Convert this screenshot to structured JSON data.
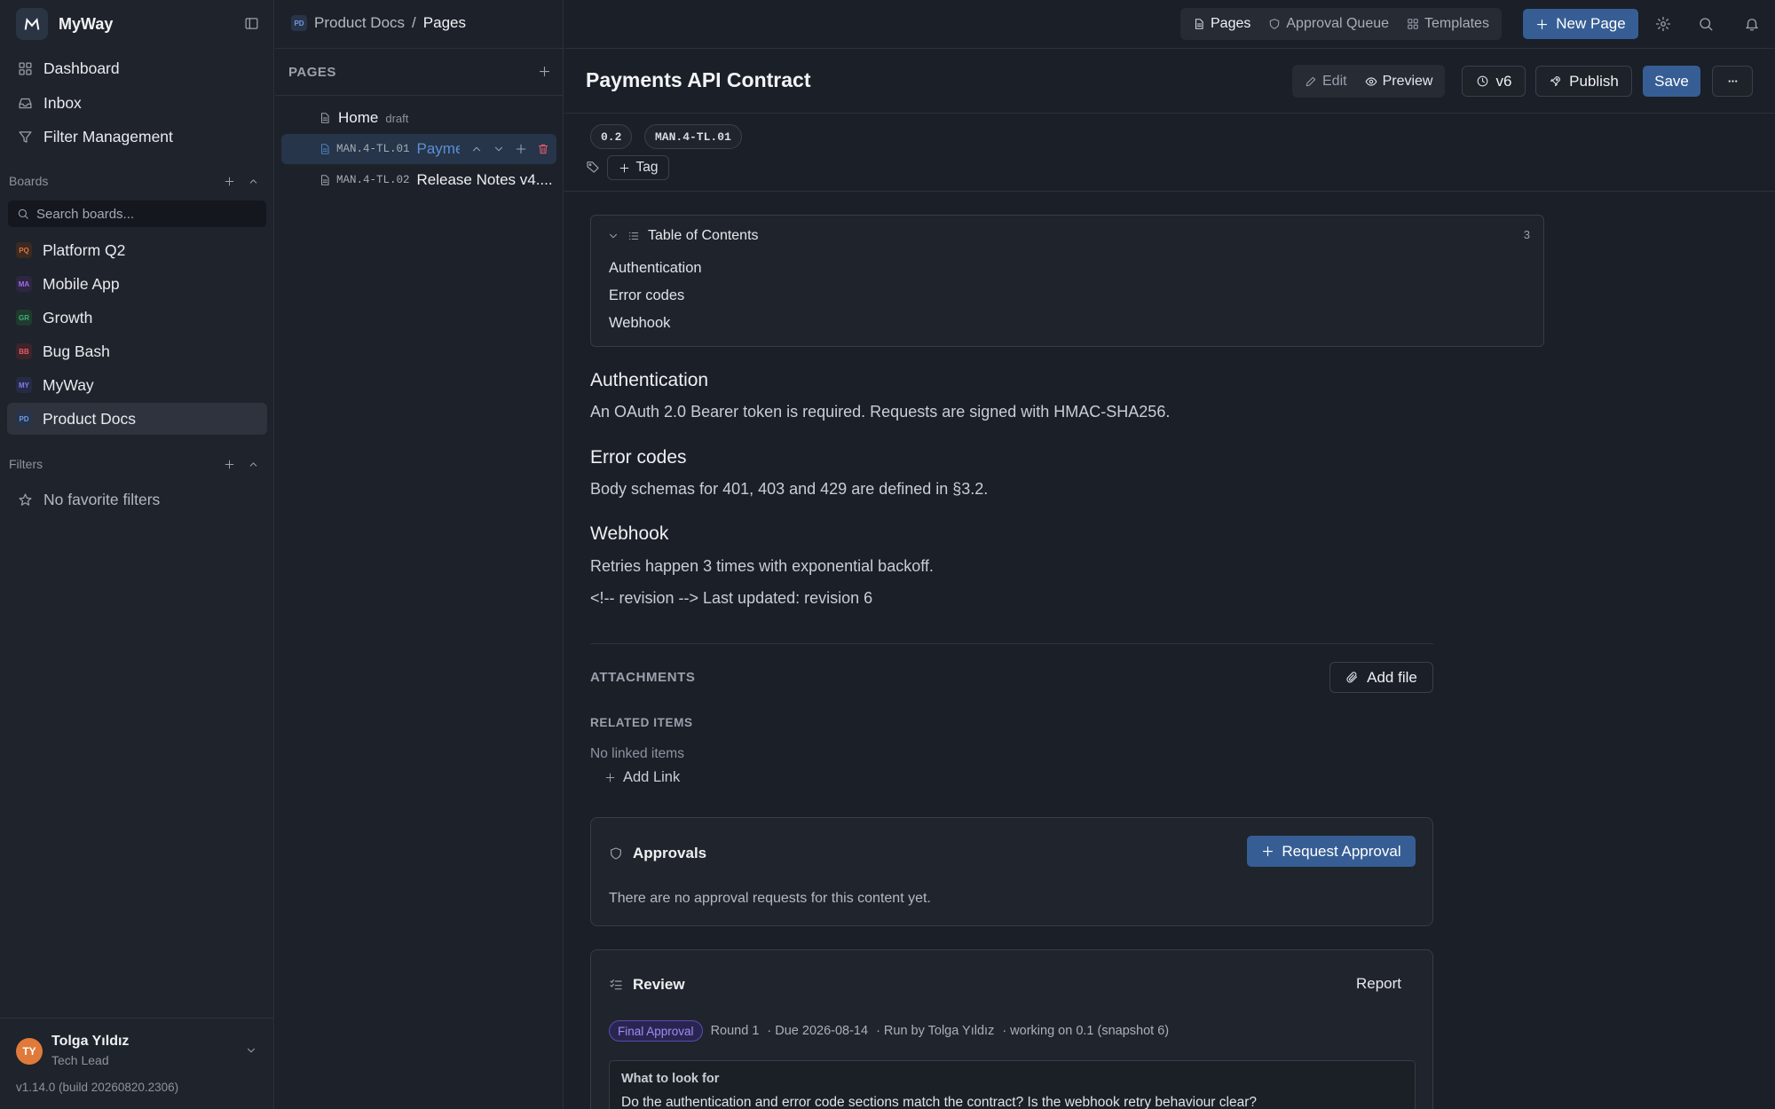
{
  "app": {
    "name": "MyWay",
    "version": "v1.14.0 (build 20260820.2306)"
  },
  "sidebar": {
    "nav": [
      {
        "label": "Dashboard",
        "icon": "grid-icon"
      },
      {
        "label": "Inbox",
        "icon": "inbox-icon"
      },
      {
        "label": "Filter Management",
        "icon": "filter-icon"
      }
    ],
    "boards_title": "Boards",
    "search_placeholder": "Search boards...",
    "boards": [
      {
        "label": "Platform Q2",
        "abbr": "PQ",
        "color": "#e0743a",
        "bg": "#3a2a22"
      },
      {
        "label": "Mobile App",
        "abbr": "MA",
        "color": "#9b6cf0",
        "bg": "#2d2640"
      },
      {
        "label": "Growth",
        "abbr": "GR",
        "color": "#3fb07a",
        "bg": "#203a2e"
      },
      {
        "label": "Bug Bash",
        "abbr": "BB",
        "color": "#e05b6a",
        "bg": "#3d2429"
      },
      {
        "label": "MyWay",
        "abbr": "MY",
        "color": "#7a7ff0",
        "bg": "#272a44"
      },
      {
        "label": "Product Docs",
        "abbr": "PD",
        "color": "#6f9ce0",
        "bg": "#283449",
        "active": true
      }
    ],
    "filters_title": "Filters",
    "no_filters": "No favorite filters",
    "user": {
      "name": "Tolga Yıldız",
      "role": "Tech Lead",
      "initials": "TY"
    }
  },
  "breadcrumb": {
    "abbr": "PD",
    "project": "Product Docs",
    "sep": "/",
    "current": "Pages"
  },
  "pages_panel": {
    "title": "PAGES",
    "items": [
      {
        "code": "",
        "title": "Home",
        "badge": "draft"
      },
      {
        "code": "MAN.4-TL.01",
        "title": "Payments API Contract",
        "selected": true
      },
      {
        "code": "MAN.4-TL.02",
        "title": "Release Notes v4...."
      }
    ]
  },
  "topbar": {
    "tabs": [
      {
        "label": "Pages",
        "icon": "file-icon",
        "active": true
      },
      {
        "label": "Approval Queue",
        "icon": "shield-icon"
      },
      {
        "label": "Templates",
        "icon": "grid-icon"
      }
    ],
    "new_page": "New Page"
  },
  "document": {
    "title": "Payments API Contract",
    "modes": {
      "edit": "Edit",
      "preview": "Preview"
    },
    "version": "v6",
    "publish": "Publish",
    "save": "Save",
    "chips": [
      "0.2",
      "MAN.4-TL.01"
    ],
    "tag_label": "Tag",
    "toc": {
      "title": "Table of Contents",
      "count": "3",
      "items": [
        "Authentication",
        "Error codes",
        "Webhook"
      ]
    },
    "sections": [
      {
        "heading": "Authentication",
        "text": "An OAuth 2.0 Bearer token is required. Requests are signed with HMAC-SHA256."
      },
      {
        "heading": "Error codes",
        "text": "Body schemas for 401, 403 and 429 are defined in §3.2."
      },
      {
        "heading": "Webhook",
        "text": "Retries happen 3 times with exponential backoff."
      }
    ],
    "revision_line": "<!-- revision --> Last updated: revision 6",
    "attachments_title": "ATTACHMENTS",
    "add_file": "Add file",
    "related_title": "RELATED ITEMS",
    "no_linked": "No linked items",
    "add_link": "Add Link"
  },
  "approvals": {
    "title": "Approvals",
    "request_button": "Request Approval",
    "empty": "There are no approval requests for this content yet."
  },
  "review": {
    "title": "Review",
    "report": "Report",
    "stage": "Final Approval",
    "round": "Round 1",
    "due": "· Due 2026-08-14",
    "run_by": "· Run by Tolga Yıldız",
    "working_on": "· working on 0.1 (snapshot 6)",
    "look_title": "What to look for",
    "look_text": "Do the authentication and error code sections match the contract? Is the webhook retry behaviour clear?"
  }
}
